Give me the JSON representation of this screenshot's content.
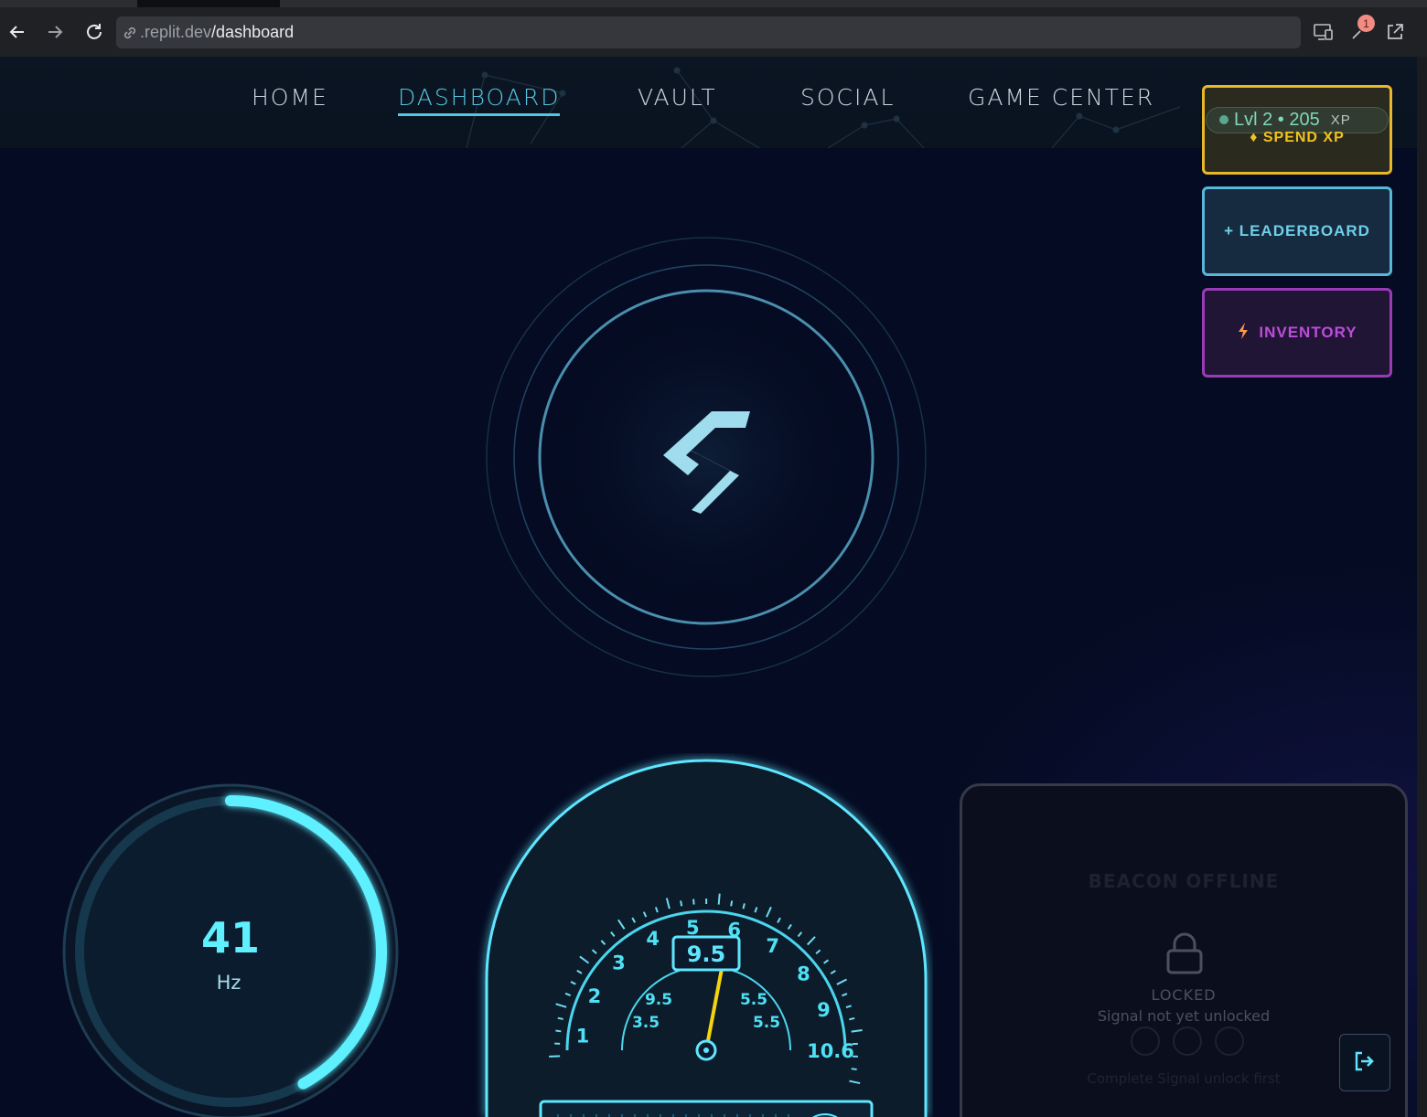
{
  "browser": {
    "url_host": ".replit.dev",
    "url_path": "/dashboard",
    "notification_count": "1"
  },
  "nav": {
    "items": [
      {
        "label": "HOME"
      },
      {
        "label": "DASHBOARD"
      },
      {
        "label": "VAULT"
      },
      {
        "label": "SOCIAL"
      },
      {
        "label": "GAME CENTER"
      }
    ],
    "active": "DASHBOARD"
  },
  "side_actions": {
    "xp": {
      "level_text": "Lvl 2 • 205",
      "unit": "XP",
      "spend_label": "♦ SPEND XP"
    },
    "leaderboard_label": "+ LEADERBOARD",
    "inventory_label": "INVENTORY",
    "inventory_icon": "bolt-icon"
  },
  "frequency_dial": {
    "value": "41",
    "unit": "Hz",
    "progress_fraction": 0.42
  },
  "speedometer": {
    "readout": "9.5",
    "outer_ticks": [
      "1",
      "2",
      "3",
      "4",
      "5",
      "6",
      "7",
      "8",
      "9",
      "10.6"
    ],
    "inner_ticks": [
      "3.5",
      "9.5",
      "5.5",
      "5.5"
    ],
    "needle_fraction": 0.56
  },
  "beacon": {
    "title": "BEACON OFFLINE",
    "locked_label": "LOCKED",
    "status_text": "Signal not yet unlocked",
    "hint_text": "Complete Signal unlock first"
  },
  "colors": {
    "accent_cyan": "#56c5e0",
    "xp_gold": "#e8b829",
    "inventory_purple": "#9a3bb6",
    "needle_yellow": "#f5d30f"
  }
}
